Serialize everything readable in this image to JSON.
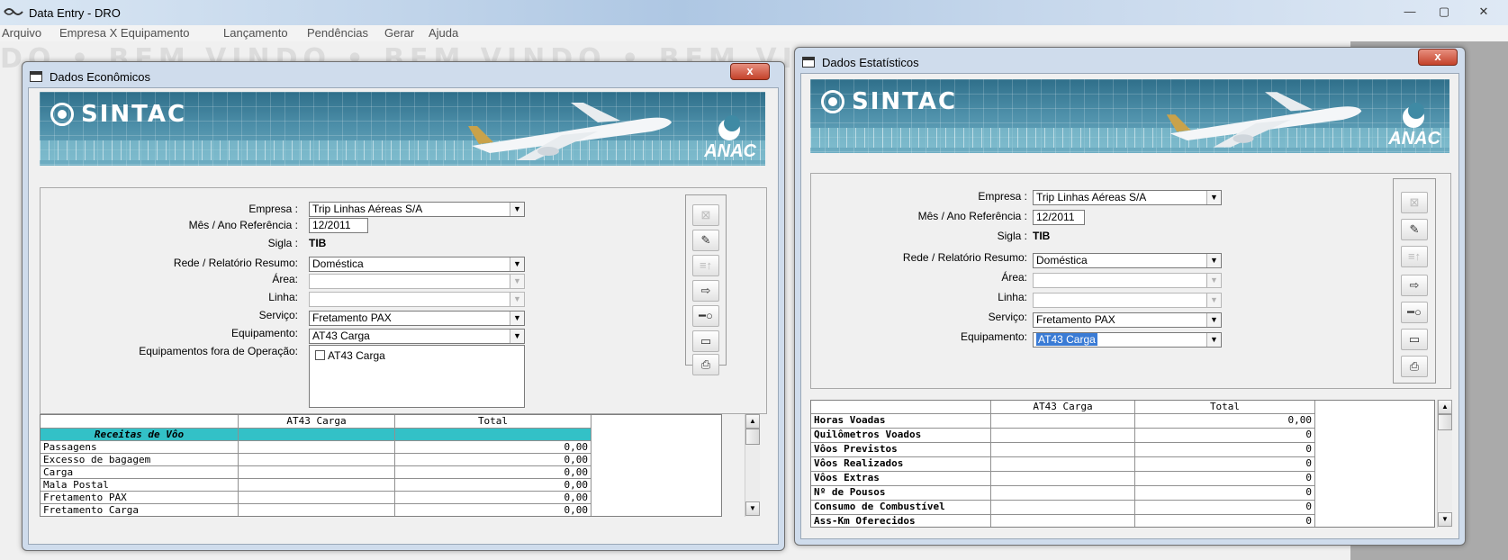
{
  "app": {
    "title": "Data Entry - DRO",
    "minimize": "—",
    "maximize": "▢",
    "close": "✕"
  },
  "menu": {
    "items": [
      {
        "label": "Arquivo"
      },
      {
        "label": "Empresa X Equipamento"
      },
      {
        "label": "Lançamento"
      },
      {
        "label": "Pendências"
      },
      {
        "label": "Gerar"
      },
      {
        "label": "Ajuda"
      }
    ]
  },
  "background_watermark": "DO • BEM VINDO • BEM VINDO • BEM VINDO • BEM VINDO • BE",
  "banner": {
    "logo": "SINTAC",
    "brand": "ANAC"
  },
  "economicos": {
    "title": "Dados Econômicos",
    "close": "x",
    "fields": {
      "empresa_label": "Empresa :",
      "empresa_value": "Trip Linhas Aéreas S/A",
      "mes_label": "Mês / Ano Referência :",
      "mes_value": "12/2011",
      "sigla_label": "Sigla :",
      "sigla_value": "TIB",
      "rede_label": "Rede / Relatório Resumo:",
      "rede_value": "Doméstica",
      "area_label": "Área:",
      "area_value": "",
      "linha_label": "Linha:",
      "linha_value": "",
      "servico_label": "Serviço:",
      "servico_value": "Fretamento PAX",
      "equip_label": "Equipamento:",
      "equip_value": "AT43  Carga",
      "fora_label": "Equipamentos fora de Operação:",
      "fora_item": "AT43 Carga"
    },
    "table": {
      "columns": [
        "",
        "AT43  Carga",
        "Total"
      ],
      "section": "Receitas de Vôo",
      "rows": [
        {
          "label": "Passagens",
          "at43": "",
          "total": "0,00"
        },
        {
          "label": "Excesso de bagagem",
          "at43": "",
          "total": "0,00"
        },
        {
          "label": "Carga",
          "at43": "",
          "total": "0,00"
        },
        {
          "label": "Mala Postal",
          "at43": "",
          "total": "0,00"
        },
        {
          "label": "Fretamento PAX",
          "at43": "",
          "total": "0,00"
        },
        {
          "label": "Fretamento Carga",
          "at43": "",
          "total": "0,00"
        }
      ]
    }
  },
  "estatisticos": {
    "title": "Dados Estatísticos",
    "close": "x",
    "fields": {
      "empresa_label": "Empresa :",
      "empresa_value": "Trip Linhas Aéreas S/A",
      "mes_label": "Mês / Ano Referência :",
      "mes_value": "12/2011",
      "sigla_label": "Sigla :",
      "sigla_value": "TIB",
      "rede_label": "Rede / Relatório Resumo:",
      "rede_value": "Doméstica",
      "area_label": "Área:",
      "area_value": "",
      "linha_label": "Linha:",
      "linha_value": "",
      "servico_label": "Serviço:",
      "servico_value": "Fretamento PAX",
      "equip_label": "Equipamento:",
      "equip_value": "AT43  Carga"
    },
    "table": {
      "columns": [
        "",
        "AT43  Carga",
        "Total"
      ],
      "rows": [
        {
          "label": "Horas Voadas",
          "at43": "",
          "total": "0,00"
        },
        {
          "label": "Quilômetros Voados",
          "at43": "",
          "total": "0"
        },
        {
          "label": "Vôos Previstos",
          "at43": "",
          "total": "0"
        },
        {
          "label": "Vôos Realizados",
          "at43": "",
          "total": "0"
        },
        {
          "label": "Vôos Extras",
          "at43": "",
          "total": "0"
        },
        {
          "label": "Nº de Pousos",
          "at43": "",
          "total": "0"
        },
        {
          "label": "Consumo de Combustível",
          "at43": "",
          "total": "0"
        },
        {
          "label": "Ass-Km Oferecidos",
          "at43": "",
          "total": "0"
        }
      ]
    }
  },
  "colors": {
    "section_header": "#33c1c7",
    "selection": "#3a7bd5",
    "close_button": "#c4422a"
  }
}
